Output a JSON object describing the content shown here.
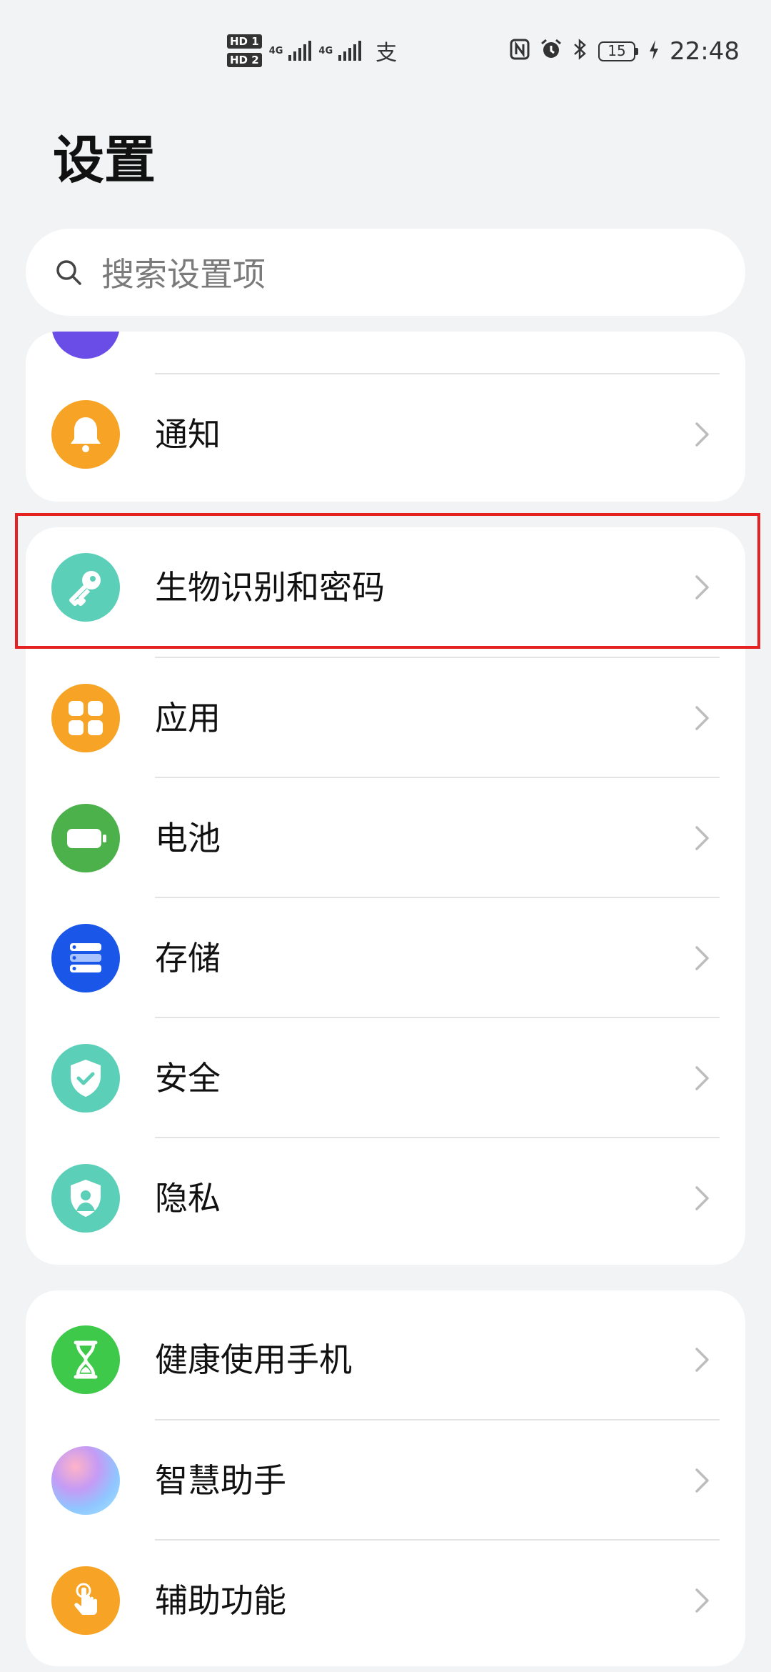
{
  "status_bar": {
    "sim1_label": "HD",
    "sim1_slot": "1",
    "sim2_label": "HD",
    "sim2_slot": "2",
    "net1": "4G",
    "net2": "4G",
    "pay_icon": "支",
    "battery_level": "15",
    "time": "22:48"
  },
  "page": {
    "title": "设置"
  },
  "search": {
    "placeholder": "搜索设置项"
  },
  "groups": [
    {
      "items": [
        {
          "label": "通知",
          "icon": "bell-icon",
          "color": "#f7a325"
        }
      ]
    },
    {
      "items": [
        {
          "label": "生物识别和密码",
          "icon": "key-icon",
          "color": "#5ccfb9"
        },
        {
          "label": "应用",
          "icon": "apps-icon",
          "color": "#f7a325"
        },
        {
          "label": "电池",
          "icon": "battery-icon",
          "color": "#4cb14b"
        },
        {
          "label": "存储",
          "icon": "storage-icon",
          "color": "#1a56e8"
        },
        {
          "label": "安全",
          "icon": "shield-icon",
          "color": "#5ccfb9"
        },
        {
          "label": "隐私",
          "icon": "privacy-icon",
          "color": "#5ccfb9"
        }
      ]
    },
    {
      "items": [
        {
          "label": "健康使用手机",
          "icon": "hourglass-icon",
          "color": "#3fc94a"
        },
        {
          "label": "智慧助手",
          "icon": "assistant-icon",
          "color": "#b79df0"
        },
        {
          "label": "辅助功能",
          "icon": "accessibility-icon",
          "color": "#f7a325"
        }
      ]
    }
  ],
  "colors": {
    "background": "#f1f3f5",
    "highlight": "#e52121",
    "accent_purple": "#6a4ce6"
  }
}
